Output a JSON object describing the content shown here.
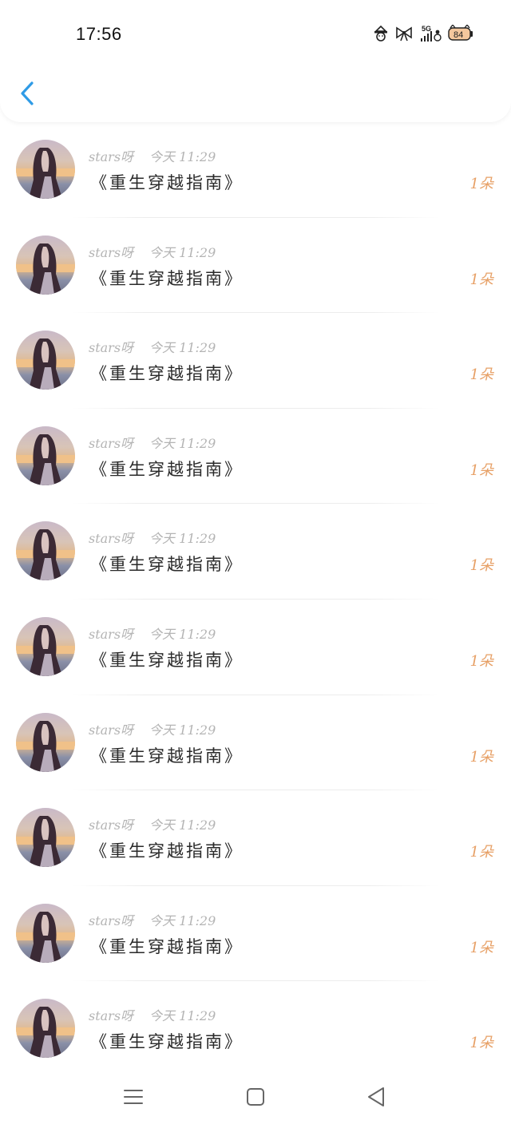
{
  "status_bar": {
    "time": "17:56",
    "network": "5G",
    "battery": "84",
    "icons": [
      "snowman-hat-icon",
      "bow-icon",
      "signal-5g-icon",
      "battery-icon"
    ]
  },
  "header": {
    "back_icon": "chevron-left-icon",
    "accent_color": "#2f9be6"
  },
  "messages": [
    {
      "user": "stars呀",
      "time": "今天 11:29",
      "title": "《重生穿越指南》",
      "count": "1朵"
    },
    {
      "user": "stars呀",
      "time": "今天 11:29",
      "title": "《重生穿越指南》",
      "count": "1朵"
    },
    {
      "user": "stars呀",
      "time": "今天 11:29",
      "title": "《重生穿越指南》",
      "count": "1朵"
    },
    {
      "user": "stars呀",
      "time": "今天 11:29",
      "title": "《重生穿越指南》",
      "count": "1朵"
    },
    {
      "user": "stars呀",
      "time": "今天 11:29",
      "title": "《重生穿越指南》",
      "count": "1朵"
    },
    {
      "user": "stars呀",
      "time": "今天 11:29",
      "title": "《重生穿越指南》",
      "count": "1朵"
    },
    {
      "user": "stars呀",
      "time": "今天 11:29",
      "title": "《重生穿越指南》",
      "count": "1朵"
    },
    {
      "user": "stars呀",
      "time": "今天 11:29",
      "title": "《重生穿越指南》",
      "count": "1朵"
    },
    {
      "user": "stars呀",
      "time": "今天 11:29",
      "title": "《重生穿越指南》",
      "count": "1朵"
    },
    {
      "user": "stars呀",
      "time": "今天 11:29",
      "title": "《重生穿越指南》",
      "count": "1朵"
    }
  ],
  "colors": {
    "count": "#e7a066",
    "meta": "#b4b4b4",
    "title": "#2a2a2a"
  },
  "navbar": {
    "icons": [
      "menu-icon",
      "home-square-icon",
      "back-triangle-icon"
    ]
  }
}
